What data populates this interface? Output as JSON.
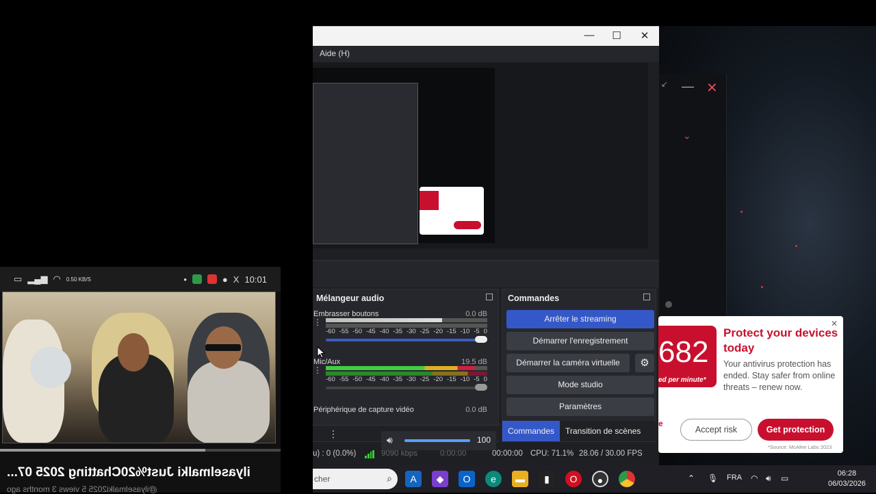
{
  "phone": {
    "time": "10:01",
    "status_right": "0.50 KB/S",
    "caption": "ilyaselmalki Just%20Chatting 2025 07...",
    "subcaption": "@ilyaselmalki2025 5 views 3 months ago"
  },
  "obs": {
    "menu_help": "Aide (H)",
    "mixer": {
      "title": "Mélangeur audio",
      "channels": [
        {
          "name": "Embrasser boutons",
          "db": "0.0 dB"
        },
        {
          "name": "Mic/Aux",
          "db": "19.5 dB"
        },
        {
          "name": "Périphérique de capture vidéo",
          "db": "0.0 dB"
        }
      ],
      "ticks": [
        "-60",
        "-55",
        "-50",
        "-45",
        "-40",
        "-35",
        "-30",
        "-25",
        "-20",
        "-15",
        "-10",
        "-5",
        "0"
      ],
      "levels": [
        0.72,
        0.93
      ]
    },
    "commands": {
      "title": "Commandes",
      "stop_stream": "Arrêter le streaming",
      "start_record": "Démarrer l'enregistrement",
      "start_vcam": "Démarrer la caméra virtuelle",
      "studio_mode": "Mode studio",
      "settings": "Paramètres",
      "tab_commands": "Commandes",
      "tab_transition": "Transition de scènes"
    },
    "volume_popup": {
      "value": "100",
      "level": 1.0
    },
    "status": {
      "dropped": "u) : 0 (0.0%)",
      "kbps": "9090 kbps",
      "rec_time": "0:00:00",
      "stream_time": "00:00:00",
      "cpu": "CPU: 71.1%",
      "fps": "28.06 / 30.00 FPS"
    }
  },
  "ad": {
    "number": "682",
    "logo_sub": "ed per minute*",
    "title": "Protect your devices today",
    "body": "Your antivirus protection has ended. Stay safer from online threats – renew now.",
    "accept": "Accept risk",
    "get": "Get protection",
    "source": "*Source: McAfee Labs 2023",
    "edge": "e"
  },
  "taskbar": {
    "search_placeholder": "cher",
    "lang": "FRA",
    "time": "06:28",
    "date": "06/03/2026"
  },
  "colors": {
    "accent": "#3558c8",
    "mcafee": "#c8102e",
    "meter_green": "#3fcf3f",
    "meter_yellow": "#e0b020",
    "meter_red": "#d02040"
  }
}
